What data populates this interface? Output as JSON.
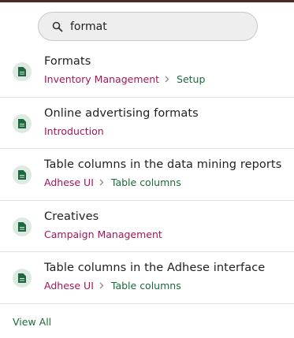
{
  "search": {
    "value": "format",
    "placeholder": ""
  },
  "results": [
    {
      "title": "Formats",
      "crumb_primary": "Inventory Management",
      "crumb_secondary": "Setup"
    },
    {
      "title": "Online advertising formats",
      "crumb_primary": "Introduction",
      "crumb_secondary": ""
    },
    {
      "title": "Table columns in the data mining reports",
      "crumb_primary": "Adhese UI",
      "crumb_secondary": "Table columns"
    },
    {
      "title": "Creatives",
      "crumb_primary": "Campaign Management",
      "crumb_secondary": ""
    },
    {
      "title": "Table columns in the Adhese interface",
      "crumb_primary": "Adhese UI",
      "crumb_secondary": "Table columns"
    }
  ],
  "footer": {
    "view_all_label": "View All"
  },
  "colors": {
    "primary_crumb": "#a0165a",
    "secondary_crumb": "#1c6a3b",
    "badge_bg": "#dde9e2",
    "top_bar": "#4a2a22"
  },
  "icons": {
    "search": "search-icon",
    "document": "document-icon",
    "separator": "chevron-right-icon"
  }
}
